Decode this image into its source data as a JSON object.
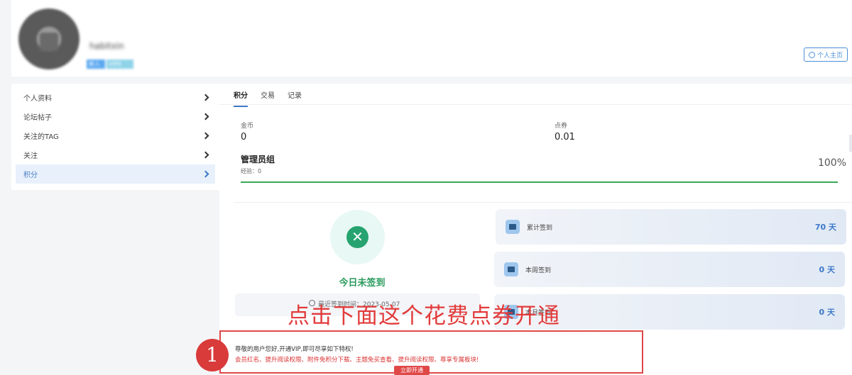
{
  "profile": {
    "username": "habitxin",
    "badge_1": "新人",
    "badge_2": "VIP0 VIP",
    "home_button": "个人主页"
  },
  "sidebar": {
    "items": [
      {
        "label": "个人资料"
      },
      {
        "label": "论坛帖子"
      },
      {
        "label": "关注的TAG"
      },
      {
        "label": "关注"
      },
      {
        "label": "积分"
      }
    ]
  },
  "tabs": [
    "积分",
    "交易",
    "记录"
  ],
  "wallet": {
    "coins_label": "金币",
    "coins_value": "0",
    "points_label": "点券",
    "points_value": "0.01"
  },
  "group": {
    "title": "管理员组",
    "exp": "经验：0",
    "percent_text": "100%",
    "progress": 1.0
  },
  "signin": {
    "status": "今日未签到",
    "status_icon": "close-circle-icon",
    "last_signin": "最近签到时间：2023-05-07"
  },
  "stats": [
    {
      "label": "累计签到",
      "value": "70 天"
    },
    {
      "label": "本周签到",
      "value": "0 天"
    },
    {
      "label": "本月签到",
      "value": "0 天"
    }
  ],
  "annotation": {
    "instruction": "点击下面这个花费点券开通",
    "step_number": "1"
  },
  "vip_box": {
    "line1": "尊敬的用户您好,开通VIP,即可尽享如下特权!",
    "line2": "会员红名、提升阅读权限、附件免积分下载、主题免买查看、提升阅读权限、尊享专属板块!",
    "button": "立即开通"
  },
  "colors": {
    "accent": "#3a78c9",
    "success": "#27a36f",
    "annotation_red": "#e23b3b"
  }
}
